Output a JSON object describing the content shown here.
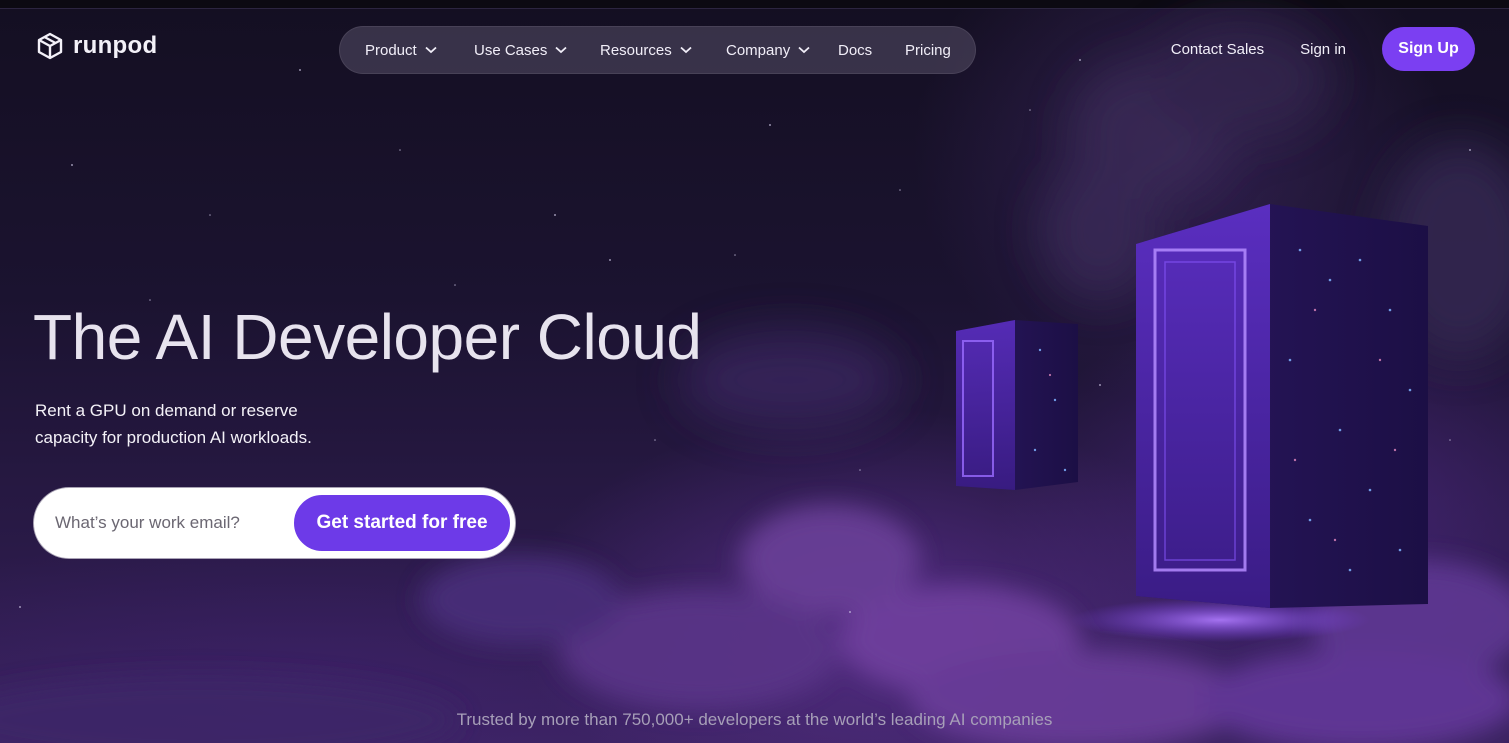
{
  "brand": {
    "name": "runpod",
    "accent": "#7b3ff2"
  },
  "nav": {
    "items": [
      {
        "label": "Product",
        "has_menu": true
      },
      {
        "label": "Use Cases",
        "has_menu": true
      },
      {
        "label": "Resources",
        "has_menu": true
      },
      {
        "label": "Company",
        "has_menu": true
      },
      {
        "label": "Docs",
        "has_menu": false
      },
      {
        "label": "Pricing",
        "has_menu": false
      }
    ],
    "contact_sales": "Contact Sales",
    "sign_in": "Sign in",
    "sign_up": "Sign Up"
  },
  "hero": {
    "title": "The AI Developer Cloud",
    "subtitle_line1": "Rent a GPU on demand or reserve",
    "subtitle_line2": "capacity for production AI workloads.",
    "email_placeholder": "What’s your work email?",
    "cta_label": "Get started for free"
  },
  "trusted_text": "Trusted by more than 750,000+ developers at the world’s leading AI companies",
  "icons": [
    "cube-logo-icon",
    "chevron-down-icon"
  ]
}
